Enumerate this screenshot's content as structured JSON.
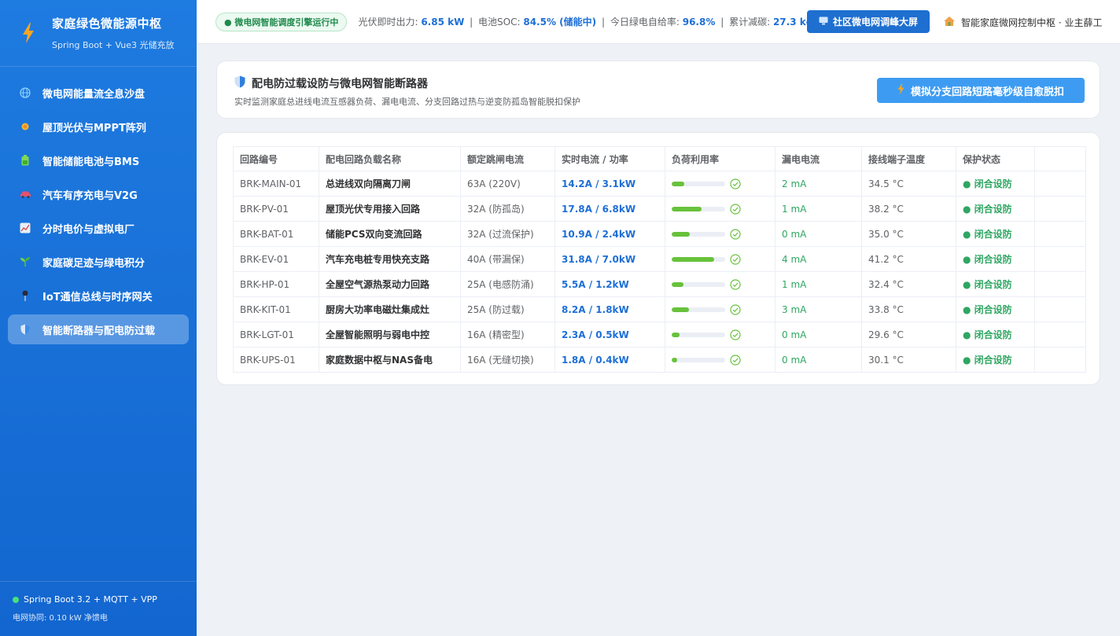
{
  "brand": {
    "title": "家庭绿色微能源中枢",
    "subtitle": "Spring Boot + Vue3 光储充放",
    "icon": "lightning-icon"
  },
  "menu": [
    {
      "label": "微电网能量流全息沙盘",
      "icon": "globe-icon",
      "active": false
    },
    {
      "label": "屋顶光伏与MPPT阵列",
      "icon": "sun-icon",
      "active": false
    },
    {
      "label": "智能储能电池与BMS",
      "icon": "battery-icon",
      "active": false
    },
    {
      "label": "汽车有序充电与V2G",
      "icon": "car-icon",
      "active": false
    },
    {
      "label": "分时电价与虚拟电厂",
      "icon": "chart-icon",
      "active": false
    },
    {
      "label": "家庭碳足迹与绿电积分",
      "icon": "sprout-icon",
      "active": false
    },
    {
      "label": "IoT通信总线与时序网关",
      "icon": "pin-icon",
      "active": false
    },
    {
      "label": "智能断路器与配电防过载",
      "icon": "shield-icon",
      "active": true
    }
  ],
  "footer": {
    "stack": "Spring Boot 3.2 + MQTT + VPP",
    "grid": "电网协同: 0.10 kW 净馈电"
  },
  "header": {
    "engine_badge": "● 微电网智能调度引擎运行中",
    "pv_label": "光伏即时出力:",
    "pv_value": "6.85 kW",
    "soc_label": "电池SOC:",
    "soc_value": "84.5% (储能中)",
    "green_label": "今日绿电自给率:",
    "green_value": "96.8%",
    "carbon_label": "累计减碳:",
    "carbon_value": "27.3 kg",
    "screen_button": "社区微电网调峰大屏",
    "user": "智能家庭微网控制中枢 · 业主薛工"
  },
  "panel": {
    "title": "配电防过载设防与微电网智能断路器",
    "description": "实时监测家庭总进线电流互感器负荷、漏电电流、分支回路过热与逆变防孤岛智能脱扣保护",
    "simulate_button": "模拟分支回路短路毫秒级自愈脱扣"
  },
  "table": {
    "columns": [
      "回路编号",
      "配电回路负载名称",
      "额定跳闸电流",
      "实时电流 / 功率",
      "负荷利用率",
      "漏电电流",
      "接线端子温度",
      "保护状态"
    ],
    "rows": [
      {
        "id": "BRK-MAIN-01",
        "name": "总进线双向隔离刀闸",
        "rated": "63A (220V)",
        "power": "14.2A / 3.1kW",
        "load": 0.23,
        "leak": "2 mA",
        "temp": "34.5 °C",
        "status": "● 闭合设防"
      },
      {
        "id": "BRK-PV-01",
        "name": "屋顶光伏专用接入回路",
        "rated": "32A (防孤岛)",
        "power": "17.8A / 6.8kW",
        "load": 0.56,
        "leak": "1 mA",
        "temp": "38.2 °C",
        "status": "● 闭合设防"
      },
      {
        "id": "BRK-BAT-01",
        "name": "储能PCS双向变流回路",
        "rated": "32A (过流保护)",
        "power": "10.9A / 2.4kW",
        "load": 0.34,
        "leak": "0 mA",
        "temp": "35.0 °C",
        "status": "● 闭合设防"
      },
      {
        "id": "BRK-EV-01",
        "name": "汽车充电桩专用快充支路",
        "rated": "40A (带漏保)",
        "power": "31.8A / 7.0kW",
        "load": 0.8,
        "leak": "4 mA",
        "temp": "41.2 °C",
        "status": "● 闭合设防"
      },
      {
        "id": "BRK-HP-01",
        "name": "全屋空气源热泵动力回路",
        "rated": "25A (电感防涌)",
        "power": "5.5A / 1.2kW",
        "load": 0.22,
        "leak": "1 mA",
        "temp": "32.4 °C",
        "status": "● 闭合设防"
      },
      {
        "id": "BRK-KIT-01",
        "name": "厨房大功率电磁灶集成灶",
        "rated": "25A (防过载)",
        "power": "8.2A / 1.8kW",
        "load": 0.33,
        "leak": "3 mA",
        "temp": "33.8 °C",
        "status": "● 闭合设防"
      },
      {
        "id": "BRK-LGT-01",
        "name": "全屋智能照明与弱电中控",
        "rated": "16A (精密型)",
        "power": "2.3A / 0.5kW",
        "load": 0.14,
        "leak": "0 mA",
        "temp": "29.6 °C",
        "status": "● 闭合设防"
      },
      {
        "id": "BRK-UPS-01",
        "name": "家庭数据中枢与NAS备电",
        "rated": "16A (无缝切换)",
        "power": "1.8A / 0.4kW",
        "load": 0.11,
        "leak": "0 mA",
        "temp": "30.1 °C",
        "status": "● 闭合设防"
      }
    ]
  },
  "colors": {
    "sidebar": "#1e7be0",
    "accent": "#1d6fd6",
    "ok": "#2fa662",
    "bar": "#67c23a"
  }
}
